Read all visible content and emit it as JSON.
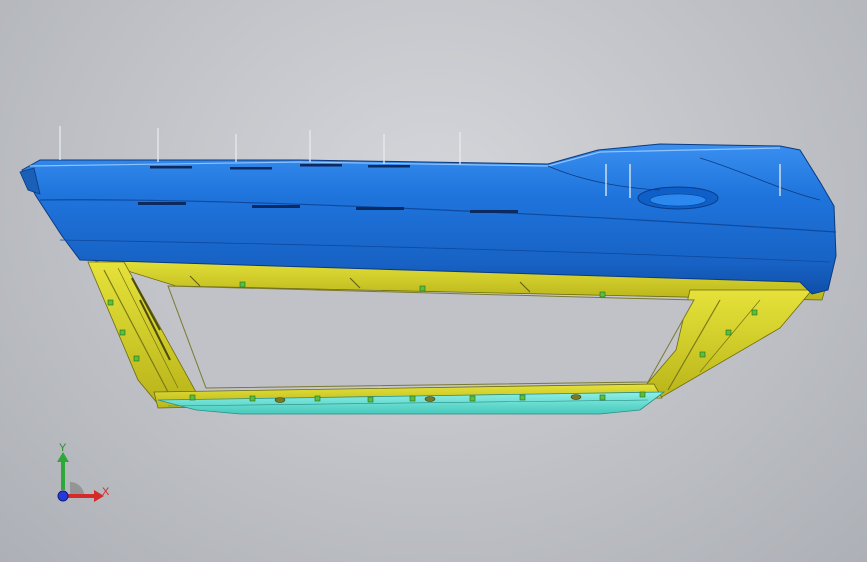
{
  "viewport": {
    "background": "#c3c5ca"
  },
  "model": {
    "parts": [
      {
        "name": "outer-skin-panel",
        "color": "#1f74dc"
      },
      {
        "name": "inner-frame",
        "color": "#d6d21f"
      },
      {
        "name": "lower-rail",
        "color": "#5fe3d6"
      },
      {
        "name": "seal-edge",
        "color": "#2fa83a"
      },
      {
        "name": "clip-markers",
        "color": "#58c03a"
      }
    ]
  },
  "triad": {
    "x_label": "X",
    "y_label": "Y",
    "x_color": "#d42a2a",
    "y_color": "#2fa83a",
    "z_color": "#2538d8"
  }
}
